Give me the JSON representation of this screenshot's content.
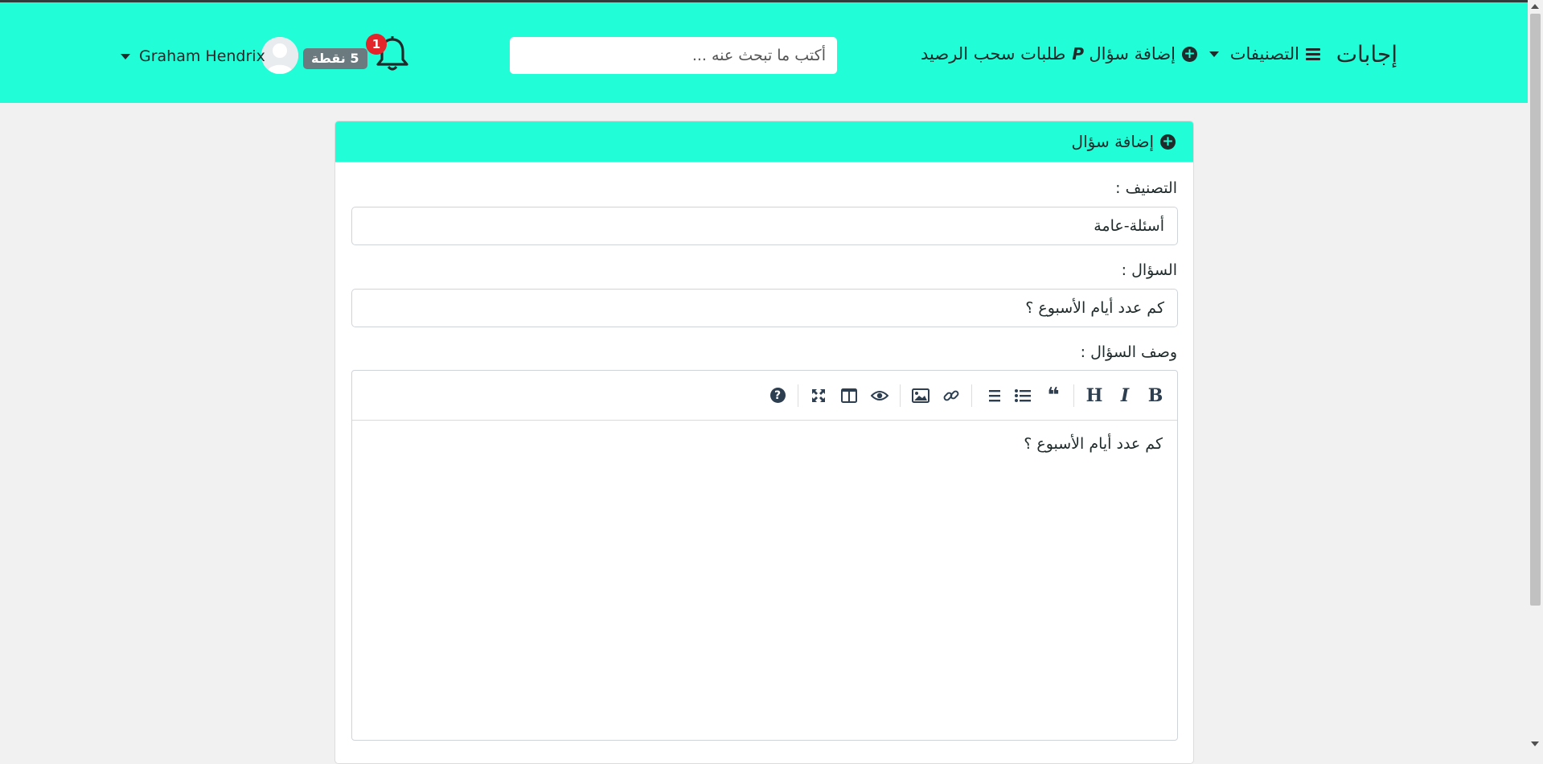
{
  "navbar": {
    "brand": "إجابات",
    "categories_label": "التصنيفات",
    "add_question_label": "إضافة سؤال",
    "withdraw_label": "طلبات سحب الرصيد",
    "search_placeholder": "أكتب ما تبحث عنه ...",
    "notification_count": "1",
    "points_badge": "5 نقطة",
    "username": "Graham Hendrix",
    "accent_color": "#21fdd7"
  },
  "card": {
    "title": "إضافة سؤال",
    "category_label": "التصنيف :",
    "category_value": "أسئلة-عامة",
    "question_label": "السؤال :",
    "question_value": "كم عدد أيام الأسبوع ؟",
    "description_label": "وصف السؤال :",
    "description_value": "كم عدد أيام الأسبوع ؟"
  },
  "toolbar": {
    "buttons": [
      "bold-icon",
      "italic-icon",
      "heading-icon",
      "quote-icon",
      "unordered-list-icon",
      "ordered-list-icon",
      "link-icon",
      "image-icon",
      "preview-icon",
      "side-by-side-icon",
      "fullscreen-icon",
      "help-icon"
    ],
    "bold": "B",
    "italic": "I",
    "heading": "H",
    "quote": "❝",
    "help": "?"
  }
}
